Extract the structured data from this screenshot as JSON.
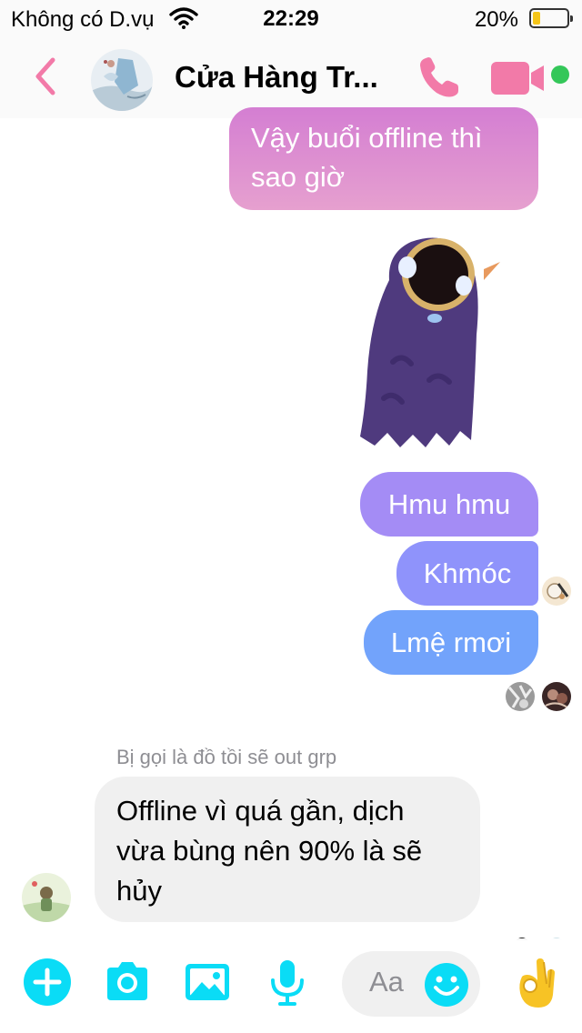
{
  "status_bar": {
    "carrier": "Không có D.vụ",
    "time": "22:29",
    "battery_percent": "20%",
    "battery_level": 0.2,
    "icons": [
      "wifi-icon",
      "battery-icon"
    ]
  },
  "header": {
    "back_icon": "chevron-left-icon",
    "title": "Cửa Hàng Tr...",
    "call_icon": "phone-icon",
    "video_icon": "video-camera-icon",
    "online_status_color": "#34c759"
  },
  "messages": [
    {
      "direction": "outgoing",
      "lines": [
        "Vậy buổi offline thì",
        "sao giờ"
      ]
    },
    {
      "direction": "outgoing",
      "type": "sticker",
      "sticker": "purple-bird-sticker"
    },
    {
      "direction": "outgoing",
      "text": "Hmu hmu"
    },
    {
      "direction": "outgoing",
      "text": "Khmóc"
    },
    {
      "direction": "outgoing",
      "text": "Lmệ rmơi"
    },
    {
      "direction": "incoming",
      "sender_label": "Bị gọi là đồ tồi sẽ out grp",
      "lines": [
        "Offline vì quá gần, dịch",
        "vừa bùng nên 90% là sẽ",
        "hủy"
      ]
    }
  ],
  "composer": {
    "placeholder": "Aa",
    "icons": [
      "plus-icon",
      "camera-icon",
      "image-icon",
      "microphone-icon",
      "smiley-icon",
      "ok-hand-icon"
    ],
    "like_emoji": "👌"
  },
  "colors": {
    "accent": "#0adcf6",
    "header_icons": "#f27aa8",
    "outgoing_bubbles": [
      "#d47ed2",
      "#a48cf5",
      "#8f93fb",
      "#72a3fb"
    ],
    "incoming_bubble": "#f0f0f0"
  }
}
